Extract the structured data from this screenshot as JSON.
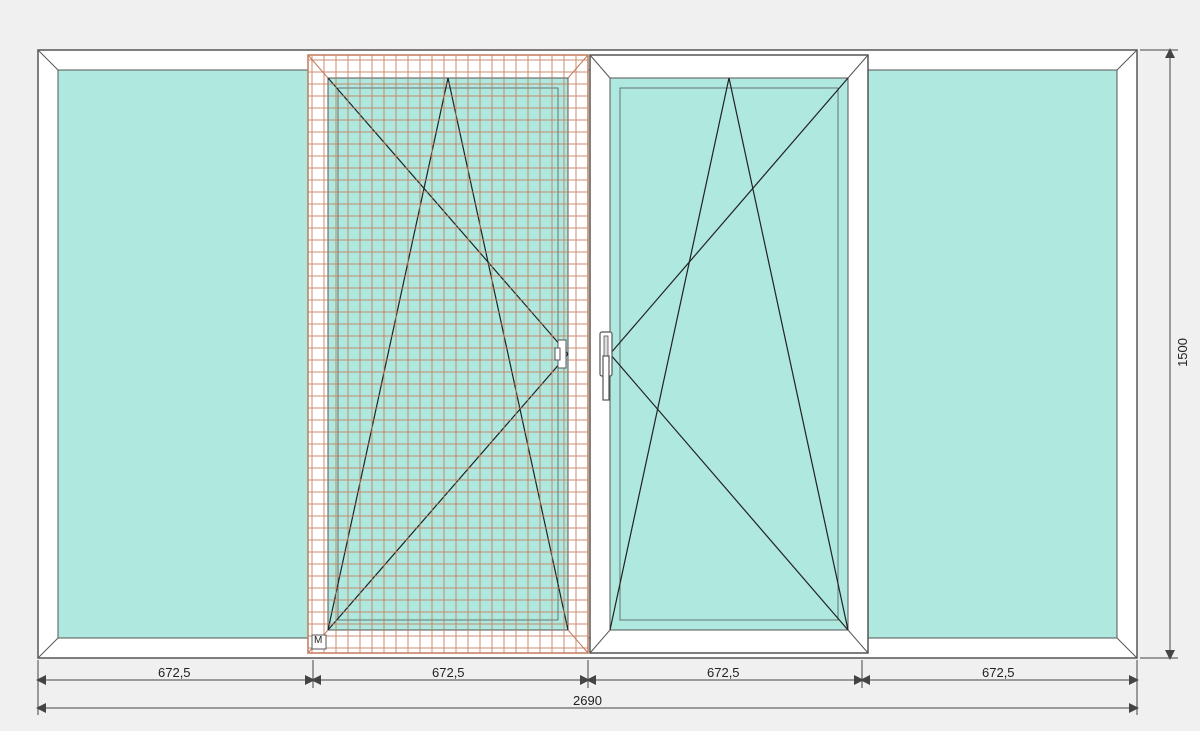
{
  "dimensions": {
    "total_width": "2690",
    "total_height": "1500",
    "panel_widths": [
      "672,5",
      "672,5",
      "672,5",
      "672,5"
    ]
  },
  "panes": {
    "pane2_mesh_label": "M"
  },
  "colors": {
    "glass": "#aee8de",
    "frame_fill": "#ffffff",
    "frame_stroke": "#555",
    "mesh": "#c47a5a",
    "line": "#333",
    "dim": "#444",
    "bg": "#f0f0f0"
  }
}
